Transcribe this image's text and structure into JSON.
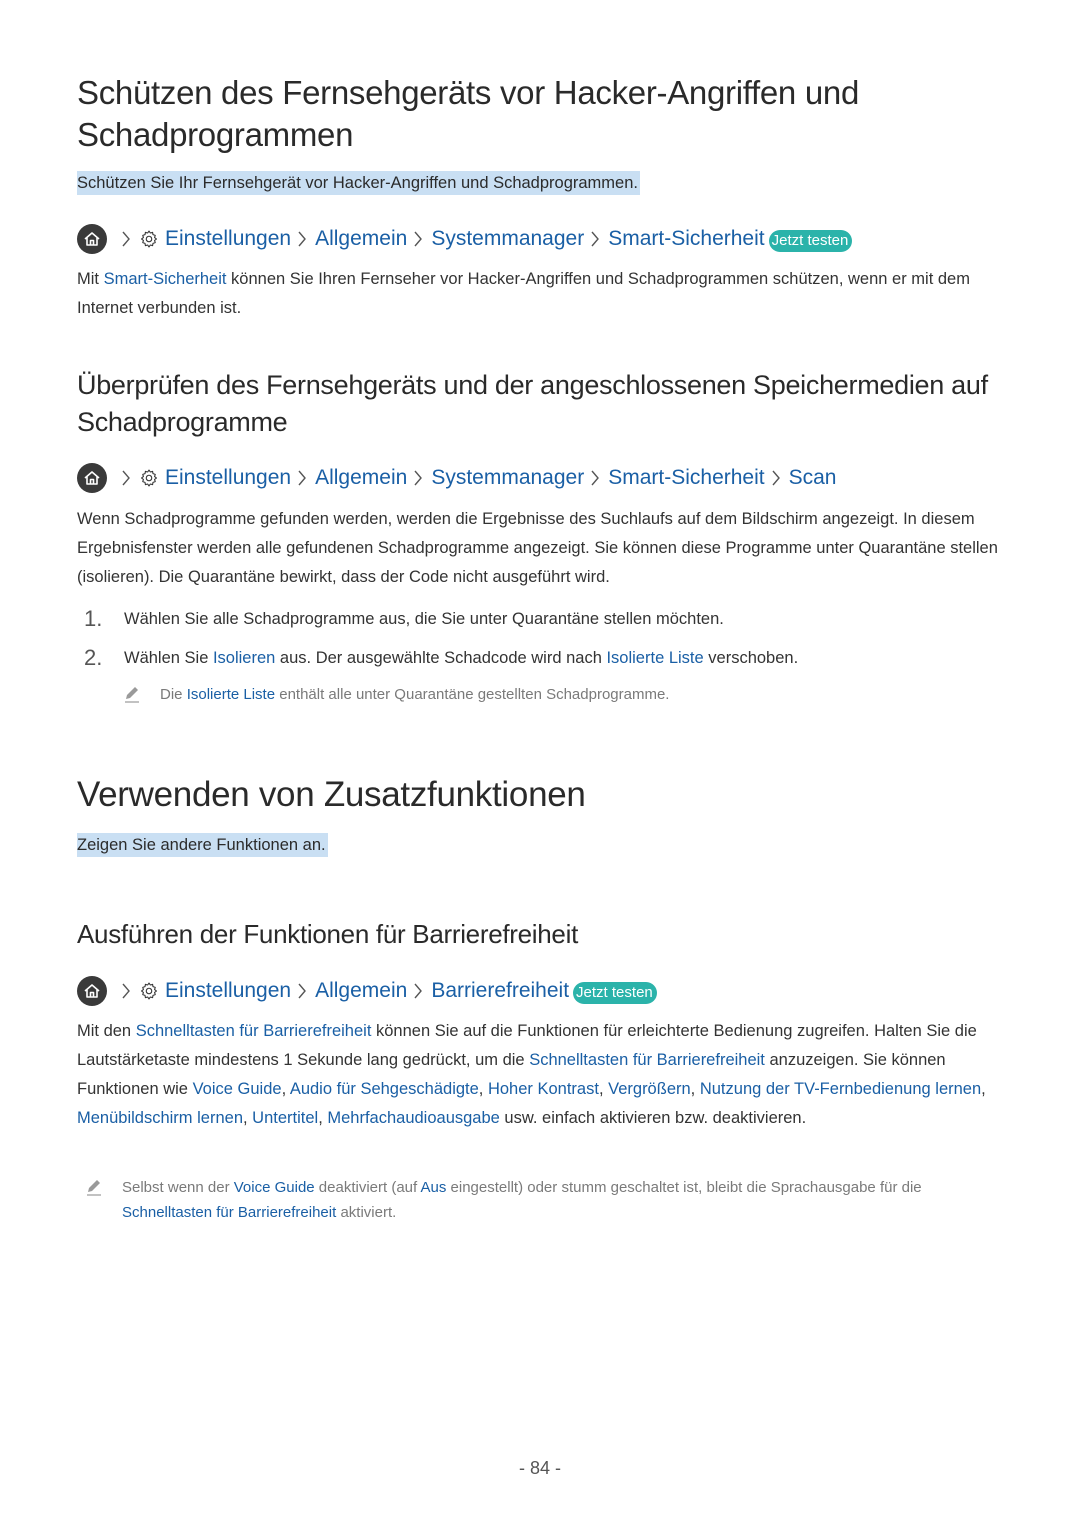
{
  "section1": {
    "title_line1": "Schützen des Fernsehgeräts vor Hacker-Angriffen und",
    "title_line2": "Schadprogrammen",
    "summary": "Schützen Sie Ihr Fernsehgerät vor Hacker-Angriffen und Schadprogrammen.",
    "path": [
      "Einstellungen",
      "Allgemein",
      "Systemmanager",
      "Smart-Sicherheit"
    ],
    "badge": "Jetzt testen",
    "body": {
      "pre": "Mit ",
      "link": "Smart-Sicherheit",
      "post": " können Sie Ihren Fernseher vor Hacker-Angriffen und Schadprogrammen schützen, wenn er mit dem Internet verbunden ist."
    }
  },
  "section2": {
    "title_line1": "Überprüfen des Fernsehgeräts und der angeschlossenen Speichermedien auf",
    "title_line2": "Schadprogramme",
    "path": [
      "Einstellungen",
      "Allgemein",
      "Systemmanager",
      "Smart-Sicherheit",
      "Scan"
    ],
    "body": "Wenn Schadprogramme gefunden werden, werden die Ergebnisse des Suchlaufs auf dem Bildschirm angezeigt. In diesem Ergebnisfenster werden alle gefundenen Schadprogramme angezeigt. Sie können diese Programme unter Quarantäne stellen (isolieren). Die Quarantäne bewirkt, dass der Code nicht ausgeführt wird.",
    "steps": [
      {
        "num": "1.",
        "text": "Wählen Sie alle Schadprogramme aus, die Sie unter Quarantäne stellen möchten."
      },
      {
        "num": "2.",
        "pre": "Wählen Sie ",
        "link1": "Isolieren",
        "mid": " aus. Der ausgewählte Schadcode wird nach ",
        "link2": "Isolierte Liste",
        "post": " verschoben."
      }
    ],
    "note": {
      "pre": "Die ",
      "link": "Isolierte Liste",
      "post": " enthält alle unter Quarantäne gestellten Schadprogramme."
    }
  },
  "section3": {
    "title": "Verwenden von Zusatzfunktionen",
    "summary": "Zeigen Sie andere Funktionen an."
  },
  "section4": {
    "title": "Ausführen der Funktionen für Barrierefreiheit",
    "path": [
      "Einstellungen",
      "Allgemein",
      "Barrierefreiheit"
    ],
    "badge": "Jetzt testen",
    "body": {
      "t1": "Mit den ",
      "l1": "Schnelltasten für Barrierefreiheit",
      "t2": " können Sie auf die Funktionen für erleichterte Bedienung zugreifen. Halten Sie die Lautstärketaste mindestens 1 Sekunde lang gedrückt, um die ",
      "l2": "Schnelltasten für Barrierefreiheit",
      "t3": " anzuzeigen. Sie können Funktionen wie ",
      "l3": "Voice Guide",
      "t4": ", ",
      "l4": "Audio für Sehgeschädigte",
      "t5": ", ",
      "l5": "Hoher Kontrast",
      "t6": ", ",
      "l6": "Vergrößern",
      "t7": ", ",
      "l7": "Nutzung der TV-Fernbedienung lernen",
      "t8": ", ",
      "l8": "Menübildschirm lernen",
      "t9": ", ",
      "l9": "Untertitel",
      "t10": ", ",
      "l10": "Mehrfachaudioausgabe",
      "t11": " usw. einfach aktivieren bzw. deaktivieren."
    },
    "note": {
      "t1": "Selbst wenn der ",
      "l1": "Voice Guide",
      "t2": " deaktiviert (auf ",
      "l2": "Aus",
      "t3": " eingestellt) oder stumm geschaltet ist, bleibt die Sprachausgabe für die ",
      "l3": "Schnelltasten für Barrierefreiheit",
      "t4": " aktiviert."
    }
  },
  "footer": {
    "page_number": "- 84 -"
  },
  "colors": {
    "link": "#1a5fa5",
    "badge": "#2bb3aa",
    "highlight": "#c9dff3",
    "home_icon_bg": "#3a3a3a"
  }
}
